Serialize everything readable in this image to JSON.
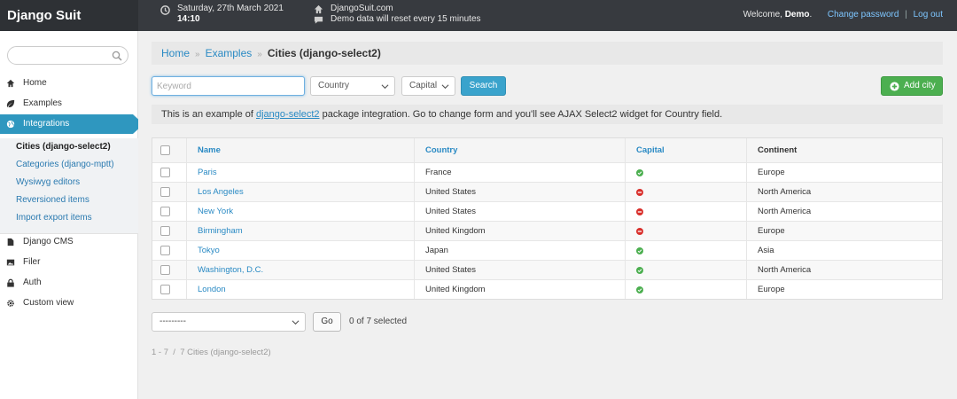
{
  "header": {
    "logo": "Django Suit",
    "date": "Saturday, 27th March 2021",
    "time": "14:10",
    "site": "DjangoSuit.com",
    "notice": "Demo data will reset every 15 minutes",
    "welcome_prefix": "Welcome, ",
    "user": "Demo",
    "welcome_suffix": ".",
    "change_password": "Change password",
    "separator": "|",
    "logout": "Log out"
  },
  "sidebar": {
    "search_placeholder": "",
    "items": [
      {
        "label": "Home",
        "icon": "home-icon"
      },
      {
        "label": "Examples",
        "icon": "leaf-icon"
      },
      {
        "label": "Integrations",
        "icon": "globe-icon"
      },
      {
        "label": "Django CMS",
        "icon": "file-icon"
      },
      {
        "label": "Filer",
        "icon": "picture-icon"
      },
      {
        "label": "Auth",
        "icon": "lock-icon"
      },
      {
        "label": "Custom view",
        "icon": "gear-icon"
      }
    ],
    "sub_items": [
      "Cities (django-select2)",
      "Categories (django-mptt)",
      "Wysiwyg editors",
      "Reversioned items",
      "Import export items"
    ]
  },
  "breadcrumb": {
    "home": "Home",
    "examples": "Examples",
    "current": "Cities (django-select2)",
    "sep": "»"
  },
  "toolbar": {
    "keyword_placeholder": "Keyword",
    "country": "Country",
    "capital": "Capital",
    "search": "Search",
    "add": "Add city"
  },
  "info": {
    "prefix": "This is an example of ",
    "link": "django-select2",
    "suffix": " package integration. Go to change form and you'll see AJAX Select2 widget for Country field."
  },
  "table": {
    "headers": [
      "Name",
      "Country",
      "Capital",
      "Continent"
    ],
    "rows": [
      {
        "name": "Paris",
        "country": "France",
        "capital": true,
        "continent": "Europe"
      },
      {
        "name": "Los Angeles",
        "country": "United States",
        "capital": false,
        "continent": "North America"
      },
      {
        "name": "New York",
        "country": "United States",
        "capital": false,
        "continent": "North America"
      },
      {
        "name": "Birmingham",
        "country": "United Kingdom",
        "capital": false,
        "continent": "Europe"
      },
      {
        "name": "Tokyo",
        "country": "Japan",
        "capital": true,
        "continent": "Asia"
      },
      {
        "name": "Washington, D.C.",
        "country": "United States",
        "capital": true,
        "continent": "North America"
      },
      {
        "name": "London",
        "country": "United Kingdom",
        "capital": true,
        "continent": "Europe"
      }
    ]
  },
  "actions": {
    "select": "---------",
    "go": "Go",
    "selected": "0 of 7 selected"
  },
  "paging": "1 - 7  /  7 Cities (django-select2)",
  "colors": {
    "accent": "#2f97bf",
    "success": "#4caf50",
    "danger": "#d9302c",
    "link": "#2a8ac4"
  }
}
